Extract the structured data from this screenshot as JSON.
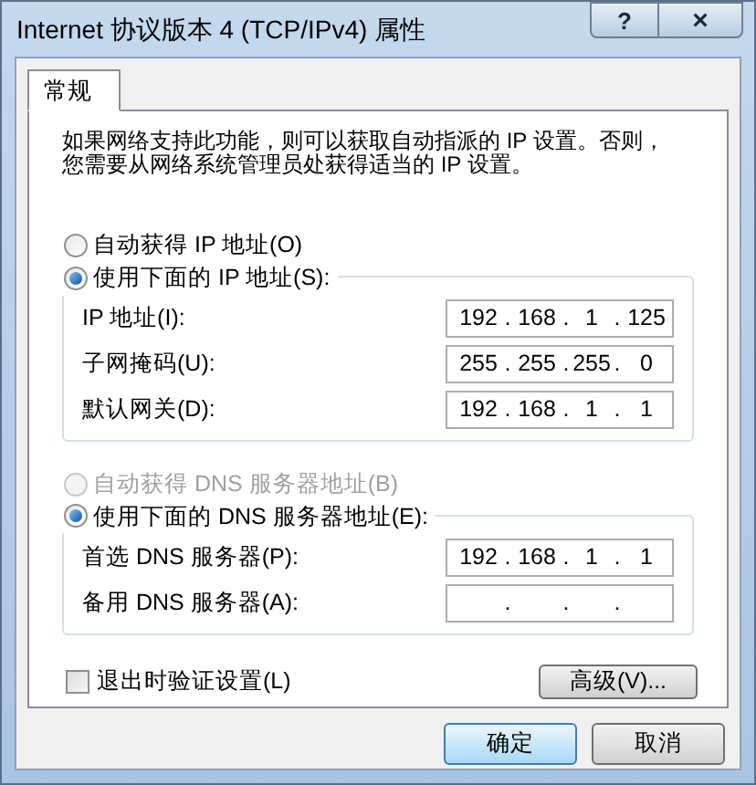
{
  "window": {
    "title": "Internet 协议版本 4 (TCP/IPv4) 属性",
    "help": "?",
    "close": "×"
  },
  "tabs": [
    {
      "label": "常规",
      "selected": true
    }
  ],
  "intro": [
    "如果网络支持此功能，则可以获取自动指派的 IP 设置。否则，",
    "您需要从网络系统管理员处获得适当的 IP 设置。"
  ],
  "sections": [
    {
      "auto": {
        "label": "自动获得 IP 地址(O)",
        "selected": false,
        "disabled": false
      },
      "manual": {
        "label": "使用下面的 IP 地址(S):",
        "selected": true,
        "disabled": false
      },
      "fields": [
        {
          "label": "IP 地址(I):",
          "octets": [
            "192",
            "168",
            "1",
            "125"
          ],
          "separators": [
            ".",
            ".",
            "."
          ]
        },
        {
          "label": "子网掩码(U):",
          "octets": [
            "255",
            "255",
            "255",
            "0"
          ],
          "separators": [
            ".",
            ".",
            "."
          ]
        },
        {
          "label": "默认网关(D):",
          "octets": [
            "192",
            "168",
            "1",
            "1"
          ],
          "separators": [
            ".",
            ".",
            "."
          ]
        }
      ]
    },
    {
      "auto": {
        "label": "自动获得 DNS 服务器地址(B)",
        "selected": false,
        "disabled": true
      },
      "manual": {
        "label": "使用下面的 DNS 服务器地址(E):",
        "selected": true,
        "disabled": false
      },
      "fields": [
        {
          "label": "首选 DNS 服务器(P):",
          "octets": [
            "192",
            "168",
            "1",
            "1"
          ],
          "separators": [
            ".",
            ".",
            "."
          ]
        },
        {
          "label": "备用 DNS 服务器(A):",
          "separators": [
            ".",
            ".",
            "."
          ]
        }
      ]
    }
  ],
  "validate": {
    "label": "退出时验证设置(L)",
    "checked": false
  },
  "advanced_button": "高级(V)...",
  "buttons": [
    {
      "label": "确定",
      "default": true
    },
    {
      "label": "取消",
      "default": false
    }
  ]
}
